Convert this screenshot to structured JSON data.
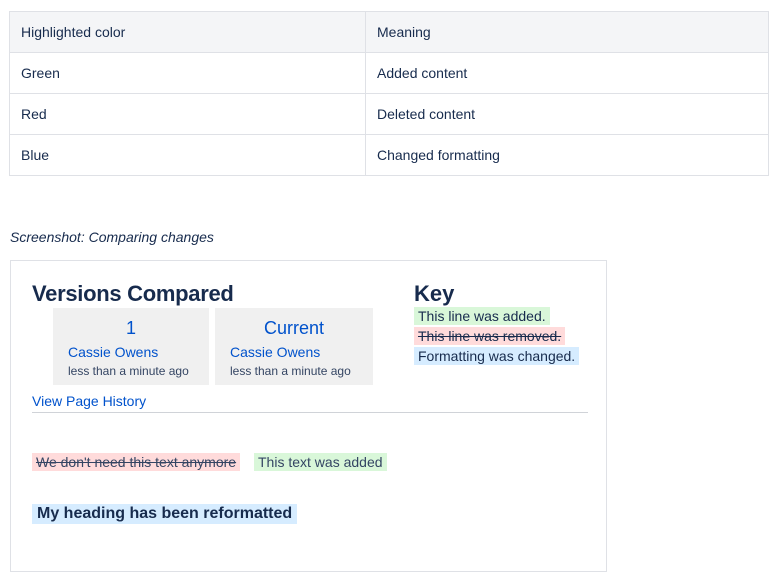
{
  "legend_table": {
    "headers": [
      "Highlighted color",
      "Meaning"
    ],
    "rows": [
      [
        "Green",
        "Added content"
      ],
      [
        "Red",
        "Deleted content"
      ],
      [
        "Blue",
        "Changed formatting"
      ]
    ]
  },
  "caption": "Screenshot: Comparing changes",
  "comparison": {
    "title": "Versions Compared",
    "versions": [
      {
        "label": "1",
        "author": "Cassie Owens",
        "time": "less than a minute ago"
      },
      {
        "label": "Current",
        "author": "Cassie Owens",
        "time": "less than a minute ago"
      }
    ],
    "history_link": "View Page History",
    "key": {
      "title": "Key",
      "added": "This line was added.",
      "removed": "This line was removed.",
      "changed": "Formatting was changed."
    },
    "diff": {
      "removed_text": "We don't need this text anymore",
      "added_text": "This text was added",
      "heading_text": "My heading has been reformatted"
    },
    "colors": {
      "added": "#d9f7d9",
      "removed": "#ffdbdb",
      "changed": "#d6ecff",
      "link": "#0052cc"
    }
  }
}
